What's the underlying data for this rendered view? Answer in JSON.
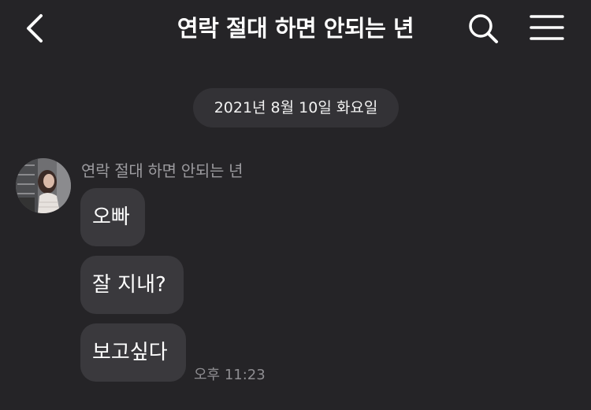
{
  "header": {
    "title": "연락 절대 하면 안되는 년"
  },
  "chat": {
    "date_divider": "2021년 8월 10일 화요일",
    "sender_name": "연락 절대 하면 안되는 년",
    "messages": [
      {
        "text": "오빠"
      },
      {
        "text": "잘 지내?"
      },
      {
        "text": "보고싶다"
      }
    ],
    "timestamp": "오후 11:23"
  },
  "icons": {
    "back": "chevron-left-icon",
    "search": "search-icon",
    "menu": "hamburger-menu-icon"
  },
  "colors": {
    "background": "#252427",
    "bubble": "#3a393d",
    "date_pill": "#333236",
    "secondary_text": "#9b9a9e"
  }
}
